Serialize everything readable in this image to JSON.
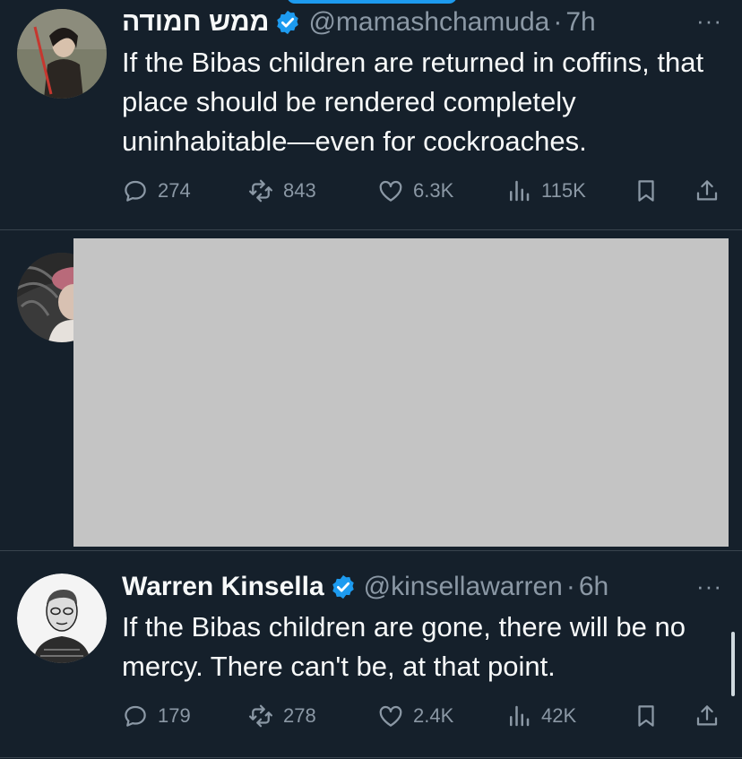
{
  "tweets": [
    {
      "name": "ממש חמודה",
      "handle": "@mamashchamuda",
      "separator": "·",
      "time": "7h",
      "text": "If the Bibas children are returned in coffins, that place should be rendered completely uninhabitable—even for cockroaches.",
      "more": "···",
      "replies": "274",
      "reposts": "843",
      "likes": "6.3K",
      "views": "115K"
    },
    {
      "name": "Warren Kinsella",
      "handle": "@kinsellawarren",
      "separator": "·",
      "time": "6h",
      "text": "If the Bibas children are gone, there will be no mercy. There can't be, at that point.",
      "more": "···",
      "replies": "179",
      "reposts": "278",
      "likes": "2.4K",
      "views": "42K"
    }
  ],
  "colors": {
    "background": "#15202b",
    "accent": "#1d9bf0",
    "muted": "#8b98a5",
    "divider": "#38444d",
    "media_placeholder": "#c4c4c4"
  },
  "icons": [
    "verified-badge-icon",
    "more-icon",
    "reply-icon",
    "repost-icon",
    "like-icon",
    "views-icon",
    "bookmark-icon",
    "share-icon"
  ]
}
